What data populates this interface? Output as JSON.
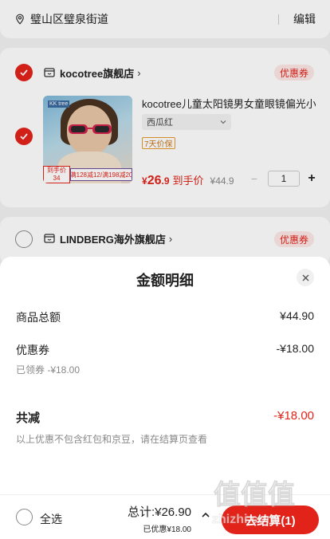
{
  "address": {
    "text": "璧山区璧泉街道",
    "edit_label": "编辑"
  },
  "stores": [
    {
      "name": "kocotree旗舰店",
      "arrow": "›",
      "coupon_label": "优惠券",
      "product": {
        "title": "kocotree儿童太阳镜男女童眼镜偏光小",
        "spec": "西瓜红",
        "tag": "7天价保",
        "price_symbol": "¥",
        "price_int": "26",
        "price_dec": ".9",
        "price_final_label": "到手价",
        "price_orig": "¥44.9",
        "qty": "1",
        "image_brand": "KK tree",
        "image_price": "到手价 34",
        "image_promo": "满128减12/满198减20"
      }
    },
    {
      "name": "LINDBERG海外旗舰店",
      "arrow": "›",
      "coupon_label": "优惠券"
    }
  ],
  "sheet": {
    "title": "金额明细",
    "goods_total_label": "商品总额",
    "goods_total_value": "¥44.90",
    "coupon_label": "优惠券",
    "coupon_value": "-¥18.00",
    "coupon_note": "已领券 -¥18.00",
    "reduce_label": "共减",
    "reduce_value": "-¥18.00",
    "note": "以上优惠不包含红包和京豆，请在结算页查看"
  },
  "footer": {
    "select_all_label": "全选",
    "total_label": "总计:¥26.90",
    "discount_label": "已优惠¥18.00",
    "checkout_label": "去结算(1)"
  },
  "watermark": {
    "line1": "值得买",
    "line2": "zhizhi.com"
  },
  "colors": {
    "accent": "#e2231a",
    "coupon_bg": "#fde8e6",
    "tag_orange": "#e89a2c"
  },
  "icons": [
    "location-pin-icon",
    "store-icon",
    "check-icon",
    "close-icon",
    "chevron-down-icon",
    "chevron-up-icon"
  ]
}
